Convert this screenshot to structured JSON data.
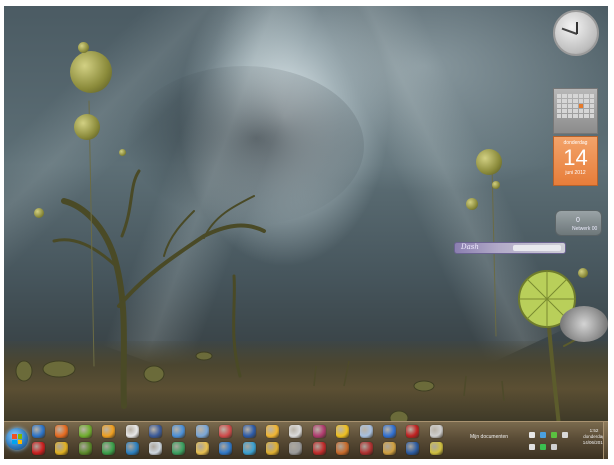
{
  "desktop": {
    "wallpaper": "dark-stormy-alien-landscape"
  },
  "gadgets": {
    "clock": {
      "icon": "analog-clock-icon"
    },
    "calendar": {
      "day_of_week": "donderdag",
      "day_number": "14",
      "month_year": "juni 2012"
    },
    "meter": {
      "value": "0",
      "label": "Netwerk 00"
    },
    "search": {
      "brand": "Dash"
    }
  },
  "taskbar": {
    "start_icon": "windows-start-orb",
    "pinned_top": [
      {
        "name": "ie-icon",
        "color": "#2a73c9"
      },
      {
        "name": "firefox-icon",
        "color": "#e66a1f"
      },
      {
        "name": "spotify-icon",
        "color": "#6fae2e"
      },
      {
        "name": "media-player-icon",
        "color": "#f0a020"
      },
      {
        "name": "panda-icon",
        "color": "#e8e8e8"
      },
      {
        "name": "image-viewer-icon",
        "color": "#3a5a9a"
      },
      {
        "name": "globe-icon",
        "color": "#4a90d9"
      },
      {
        "name": "monitor-icon",
        "color": "#7aa7d8"
      },
      {
        "name": "paint-icon",
        "color": "#d04a4a"
      },
      {
        "name": "word-icon",
        "color": "#2b5aa8"
      },
      {
        "name": "photo-icon",
        "color": "#f2b632"
      },
      {
        "name": "sheep-icon",
        "color": "#dcdcdc"
      },
      {
        "name": "video-editor-icon",
        "color": "#b03a6e"
      },
      {
        "name": "messenger-icon",
        "color": "#f0c020"
      },
      {
        "name": "moon-icon",
        "color": "#a8c0e0"
      },
      {
        "name": "bluetooth-icon",
        "color": "#2f6fd1"
      },
      {
        "name": "flag-icon",
        "color": "#c02020"
      },
      {
        "name": "disc-icon",
        "color": "#cfcfcf"
      }
    ],
    "pinned_bottom": [
      {
        "name": "opera-icon",
        "color": "#cc1f1f"
      },
      {
        "name": "chrome-icon",
        "color": "#e0b020"
      },
      {
        "name": "frog-icon",
        "color": "#5a8a2a"
      },
      {
        "name": "recycle-icon",
        "color": "#3aa04a"
      },
      {
        "name": "refresh-icon",
        "color": "#2a7fc0"
      },
      {
        "name": "magnifier-icon",
        "color": "#cfd8e0"
      },
      {
        "name": "update-icon",
        "color": "#3aa060"
      },
      {
        "name": "folder-icon",
        "color": "#e8c050"
      },
      {
        "name": "network-icon",
        "color": "#2f78c8"
      },
      {
        "name": "security-icon",
        "color": "#3aa0d0"
      },
      {
        "name": "puzzle-icon",
        "color": "#e0b030"
      },
      {
        "name": "printer-icon",
        "color": "#9a9a9a"
      },
      {
        "name": "pdf-icon",
        "color": "#c02a2a"
      },
      {
        "name": "tools-icon",
        "color": "#c86a2a"
      },
      {
        "name": "calendar-app-icon",
        "color": "#b03030"
      },
      {
        "name": "mail-icon",
        "color": "#d0a040"
      },
      {
        "name": "download-icon",
        "color": "#2a5aa0"
      },
      {
        "name": "star-icon",
        "color": "#d0c040"
      }
    ],
    "my_documents_label": "Mijn documenten",
    "clock_time": "1:52",
    "clock_day": "donderdag",
    "clock_date": "14/06/2012",
    "tray_icons": [
      {
        "name": "up-arrow-icon",
        "color": "#e8e8e8"
      },
      {
        "name": "cloud-icon",
        "color": "#4aa0e0"
      },
      {
        "name": "battery-icon",
        "color": "#5ac040"
      },
      {
        "name": "speaker-icon",
        "color": "#d8d8d8"
      },
      {
        "name": "network-tray-icon",
        "color": "#e0e0e0"
      },
      {
        "name": "shield-icon",
        "color": "#3ac050"
      },
      {
        "name": "action-center-icon",
        "color": "#d0d0d0"
      }
    ]
  }
}
